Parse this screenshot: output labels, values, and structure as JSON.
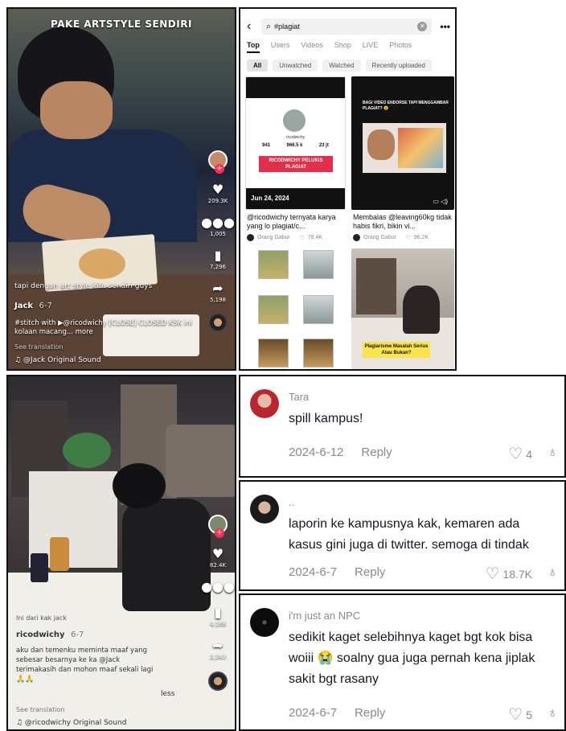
{
  "video1": {
    "title": "PAKE ARTSTYLE SENDIRI",
    "overlay_text": "tapi dengan art style kita sendiri guys",
    "author": "Jack",
    "date": "6-7",
    "description": "#stitch with ▶@ricodwichy [CLOSE] CLOSED KSK ini kolaan macang... more",
    "see_translation": "See translation",
    "sound": "♫ @Jack Original Sound",
    "likes": "209.3K",
    "comments": "1,005",
    "saves": "7,296",
    "shares": "5,198"
  },
  "search": {
    "query": "#plagiat",
    "tabs": [
      "Top",
      "Users",
      "Videos",
      "Shop",
      "LIVE",
      "Photos"
    ],
    "chips": [
      "All",
      "Unwatched",
      "Watched",
      "Recently uploaded"
    ],
    "result1": {
      "date": "Jun 24, 2024",
      "handle": "ricodwichy",
      "stats": [
        "941",
        "966.5 k",
        "23 jt"
      ],
      "banner_line1": "RICODWICHY PELUKIS",
      "banner_line2": "PLAGIAT",
      "caption": "@ricodwichy ternyata karya yang lo plagiat/c...",
      "user": "Orang Gabut",
      "likes": "78.4K"
    },
    "result2": {
      "announce": "BAGI VIDEO ENDORSE TAPI MENGGAMBAR PLAGIAT? 😮",
      "caption": "Membalas @leaving60kg tidak habis fikri, bikin vi...",
      "user": "Orang Gabut",
      "likes": "96.2K"
    },
    "result4": {
      "label": "Plagiarisme Masalah Serius Atau Bukan?"
    }
  },
  "video2": {
    "reply_to": "Ini dari kak jack",
    "author": "ricodwichy",
    "date": "6-7",
    "caption_line1": "aku dan temenku meminta maaf yang",
    "caption_line2": "sebesar besarnya ke ka @Jack",
    "caption_line3": "terimakasih dan mohon maaf sekali lagi",
    "caption_line4": "🙏🙏",
    "less": "less",
    "see_translation": "See translation",
    "sound": "♫ @ricodwichy Original Sound",
    "likes": "82.4K",
    "comments": "",
    "saves": "4,168",
    "shares": "2,343"
  },
  "comments": [
    {
      "user": "Tara",
      "text": "spill kampus!",
      "date": "2024-6-12",
      "reply": "Reply",
      "likes": "4"
    },
    {
      "user": "..",
      "text": "laporin ke kampusnya kak, kemaren ada kasus gini juga di twitter. semoga di tindak",
      "date": "2024-6-7",
      "reply": "Reply",
      "likes": "18.7K"
    },
    {
      "user": "i'm just an NPC",
      "text": "sedikit kaget selebihnya kaget bgt kok bisa woiii 😭 soalny gua juga pernah kena jiplak sakit bgt rasany",
      "date": "2024-6-7",
      "reply": "Reply",
      "likes": "5"
    }
  ],
  "colors": {
    "tiktok_red": "#fe2c55",
    "banner_red": "#e2304b",
    "label_yellow": "#fbe44a"
  }
}
